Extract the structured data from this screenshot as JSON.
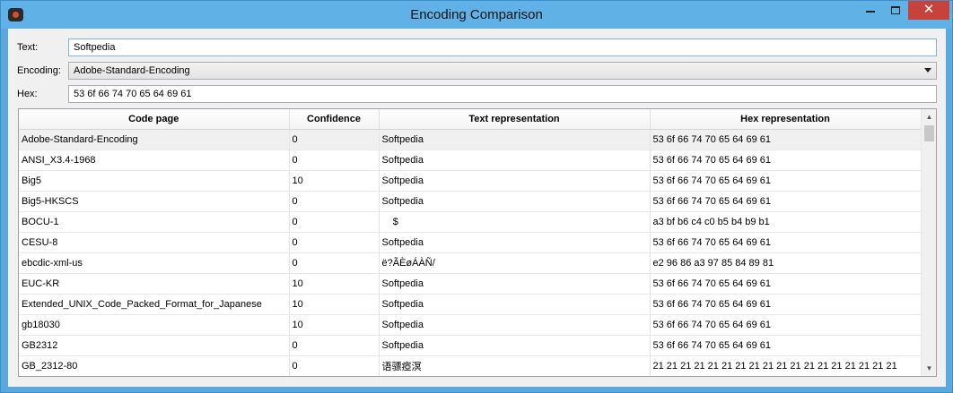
{
  "window": {
    "title": "Encoding Comparison"
  },
  "form": {
    "text_label": "Text:",
    "text_value": "Softpedia",
    "encoding_label": "Encoding:",
    "encoding_value": "Adobe-Standard-Encoding",
    "hex_label": "Hex:",
    "hex_value": "53 6f 66 74 70 65 64 69 61"
  },
  "table": {
    "columns": [
      "Code page",
      "Confidence",
      "Text representation",
      "Hex representation"
    ],
    "selected_row": 0,
    "rows": [
      [
        "Adobe-Standard-Encoding",
        "0",
        "Softpedia",
        "53 6f 66 74 70 65 64 69 61"
      ],
      [
        "ANSI_X3.4-1968",
        "0",
        "Softpedia",
        "53 6f 66 74 70 65 64 69 61"
      ],
      [
        "Big5",
        "10",
        "Softpedia",
        "53 6f 66 74 70 65 64 69 61"
      ],
      [
        "Big5-HKSCS",
        "0",
        "Softpedia",
        "53 6f 66 74 70 65 64 69 61"
      ],
      [
        "BOCU-1",
        "0",
        "    $",
        "a3 bf b6 c4 c0 b5 b4 b9 b1"
      ],
      [
        "CESU-8",
        "0",
        "Softpedia",
        "53 6f 66 74 70 65 64 69 61"
      ],
      [
        "ebcdic-xml-us",
        "0",
        "ë?ÃÈøÁÀÑ/",
        "e2 96 86 a3 97 85 84 89 81"
      ],
      [
        "EUC-KR",
        "10",
        "Softpedia",
        "53 6f 66 74 70 65 64 69 61"
      ],
      [
        "Extended_UNIX_Code_Packed_Format_for_Japanese",
        "10",
        "Softpedia",
        "53 6f 66 74 70 65 64 69 61"
      ],
      [
        "gb18030",
        "10",
        "Softpedia",
        "53 6f 66 74 70 65 64 69 61"
      ],
      [
        "GB2312",
        "0",
        "Softpedia",
        "53 6f 66 74 70 65 64 69 61"
      ],
      [
        "GB_2312-80",
        "0",
        "语骠瘂溟",
        "21 21 21 21 21 21 21 21 21 21 21 21 21 21 21 21 21 21"
      ]
    ]
  },
  "icons": {
    "minimize": "minimize-icon",
    "maximize": "maximize-icon",
    "close": "close-icon",
    "dropdown": "chevron-down-icon",
    "scroll_up": "scroll-up-icon",
    "scroll_down": "scroll-down-icon"
  },
  "colors": {
    "titlebar": "#5fb1e6",
    "close_button": "#c7423a",
    "input_focus_border": "#7eb4ea"
  }
}
